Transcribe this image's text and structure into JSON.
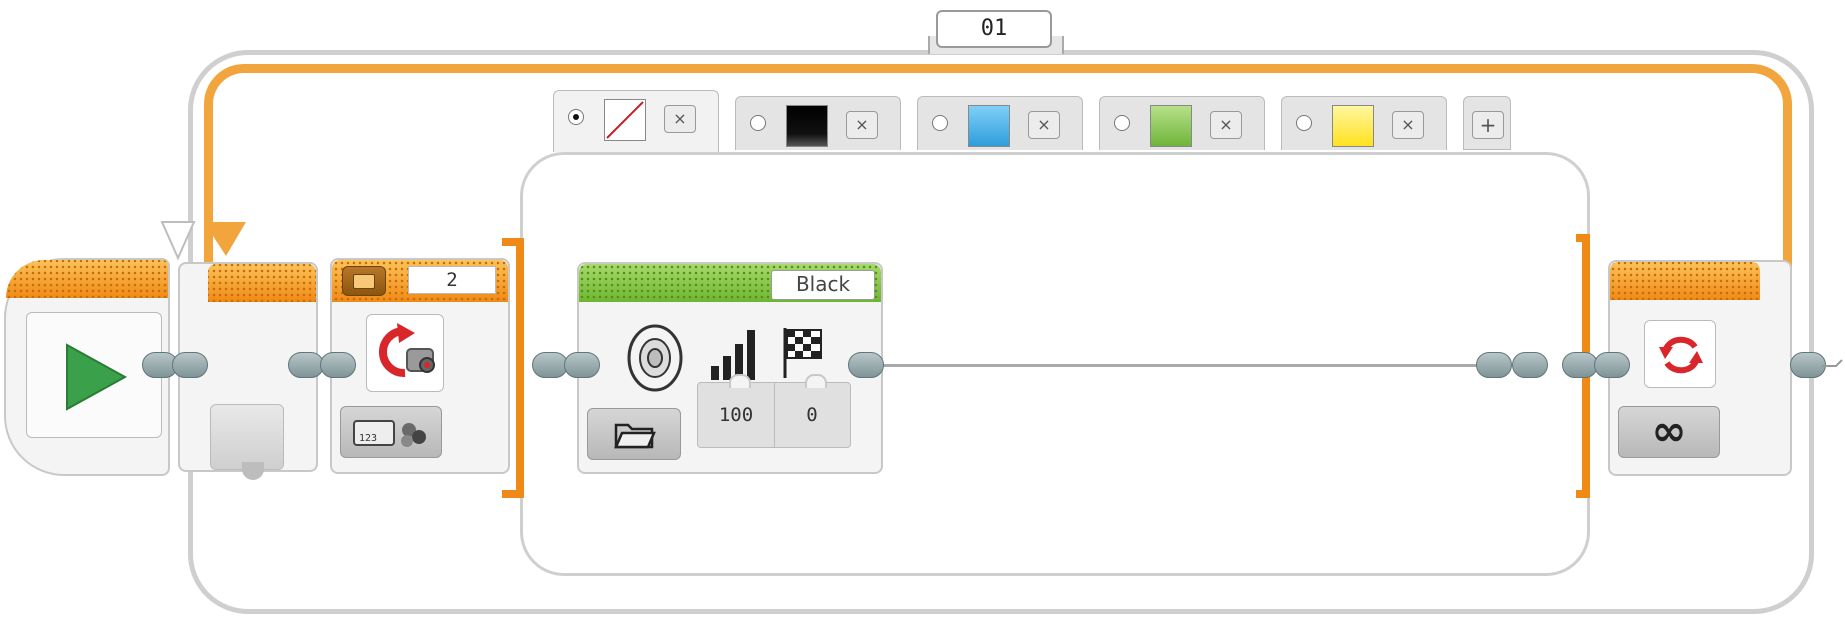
{
  "loop": {
    "name": "01",
    "mode_icon": "infinity-icon",
    "mode_symbol": "∞",
    "accent": "#f3a53d"
  },
  "start_block": {
    "icon": "play-icon",
    "color": "#3aa14a"
  },
  "switch": {
    "port": "2",
    "sensor_icon": "color-sensor-icon",
    "mode_icon": "measure-color-icon",
    "cases": [
      {
        "selected": true,
        "swatch": "none",
        "swatch_color": "#ffffff",
        "remove_label": "×"
      },
      {
        "selected": false,
        "swatch": "black",
        "swatch_color": "#000000",
        "remove_label": "×"
      },
      {
        "selected": false,
        "swatch": "blue",
        "swatch_color": "#36a9e6",
        "remove_label": "×"
      },
      {
        "selected": false,
        "swatch": "green",
        "swatch_color": "#7cc142",
        "remove_label": "×"
      },
      {
        "selected": false,
        "swatch": "yellow",
        "swatch_color": "#ffe83a",
        "remove_label": "×"
      }
    ],
    "add_case_label": "+"
  },
  "sound_block": {
    "file": "Black",
    "volume": "100",
    "play_type": "0",
    "icons": [
      "speaker-icon",
      "volume-icon",
      "play-type-icon",
      "folder-icon"
    ]
  }
}
